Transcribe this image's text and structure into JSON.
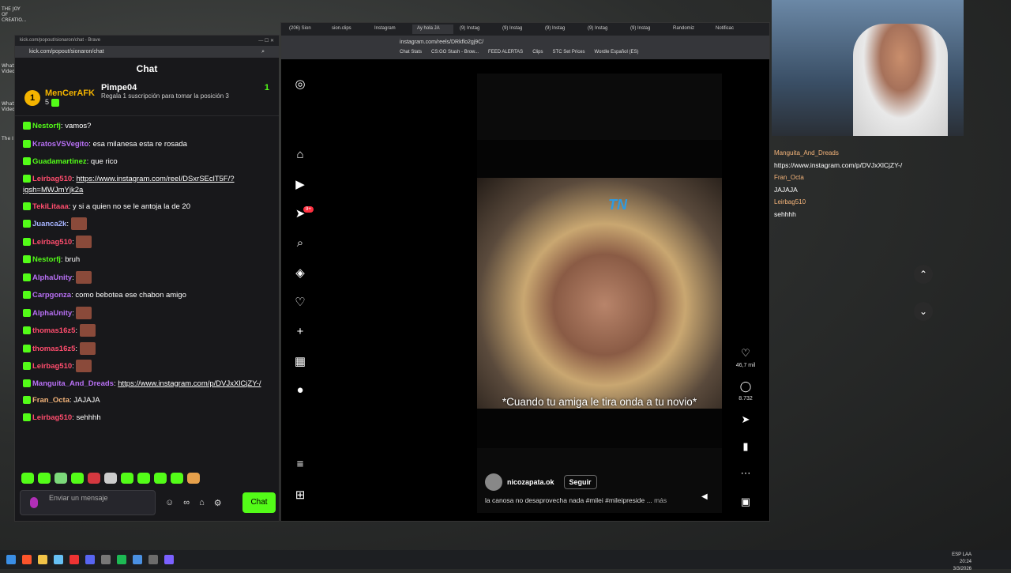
{
  "desktop": {
    "icons": [
      "THE JOY OF CREATIO...",
      "What Video",
      "What Video",
      "The I"
    ]
  },
  "chat_window": {
    "title": "kick.com/popout/sionaron/chat - Brave",
    "url": "kick.com/popout/sionaron/chat",
    "header": "Chat",
    "pinned": {
      "rank": "1",
      "user1": "MenCerAFK",
      "user1_count": "5",
      "user2": "Pimpe04",
      "user2_count": "1",
      "note": "Regala 1 suscripción para tomar la posición 3"
    },
    "messages": [
      {
        "user": "Nestorfj",
        "color": "#53fc18",
        "text": "vamos?"
      },
      {
        "user": "KratosVSVegito",
        "color": "#b870f5",
        "text": "esa milanesa esta re rosada"
      },
      {
        "user": "Guadamartinez",
        "color": "#53fc18",
        "text": "que rico"
      },
      {
        "user": "Leirbag510",
        "color": "#ff4d6d",
        "text": "https://www.instagram.com/reel/DSxrSEclT5F/?igsh=MWJmYjk2a",
        "link": true
      },
      {
        "user": "TekiLitaaa",
        "color": "#ff4d6d",
        "text": "y si a quien no se le antoja la de 20"
      },
      {
        "user": "Juanca2k",
        "color": "#a6b4ff",
        "text": ""
      },
      {
        "user": "Leirbag510",
        "color": "#ff4d6d",
        "text": ""
      },
      {
        "user": "Nestorfj",
        "color": "#53fc18",
        "text": "bruh"
      },
      {
        "user": "AlphaUnity",
        "color": "#b870f5",
        "text": ""
      },
      {
        "user": "Carpgonza",
        "color": "#b870f5",
        "text": "como bebotea ese chabon amigo"
      },
      {
        "user": "AlphaUnity",
        "color": "#b870f5",
        "text": ""
      },
      {
        "user": "thomas16z5",
        "color": "#ff4d6d",
        "text": ""
      },
      {
        "user": "thomas16z5",
        "color": "#ff4d6d",
        "text": ""
      },
      {
        "user": "Leirbag510",
        "color": "#ff4d6d",
        "text": ""
      },
      {
        "user": "Manguita_And_Dreads",
        "color": "#b870f5",
        "text": "https://www.instagram.com/p/DVJxXlCjZY-/",
        "link": true
      },
      {
        "user": "Fran_Octa",
        "color": "#f4b47a",
        "text": "JAJAJA"
      },
      {
        "user": "Leirbag510",
        "color": "#ff4d6d",
        "text": "sehhhh"
      }
    ],
    "input_placeholder": "Enviar un mensaje",
    "send_label": "Chat"
  },
  "browser": {
    "tabs": [
      "(206) Sion",
      "sion.clips",
      "Instagram",
      "Ay hola JA",
      "(9) Instag",
      "(9) Instag",
      "(9) Instag",
      "(9) Instag",
      "(9) Instag",
      "Randomiz",
      "Notificac"
    ],
    "url": "instagram.com/reels/DRkflo2gj9C/",
    "bookmarks": [
      "Chat Stats",
      "CS:GO Stash - Brow...",
      "FEED ALERTAS",
      "Clips",
      "STC Set Prices",
      "Wordle Español (ES)"
    ],
    "reel": {
      "overlay_logo": "TN",
      "caption": "*Cuando tu amiga le tira onda a tu novio*",
      "author": "nicozapata.ok",
      "follow": "Seguir",
      "description": "la canosa no desaprovecha nada #milei #mileipreside ...",
      "more": "más",
      "likes": "46,7 mil",
      "comments": "8.732"
    },
    "notification_badge": "9+"
  },
  "overlay_chat": [
    {
      "user": "Manguita_And_Dreads",
      "text": "https://www.instagram.com/p/DVJxXlCjZY-/"
    },
    {
      "user": "Fran_Octa",
      "text": "JAJAJA"
    },
    {
      "user": "Leirbag510",
      "text": "sehhhh"
    }
  ],
  "taskbar": {
    "lang": "ESP LAA",
    "time": "20:24",
    "date": "3/3/2026"
  }
}
